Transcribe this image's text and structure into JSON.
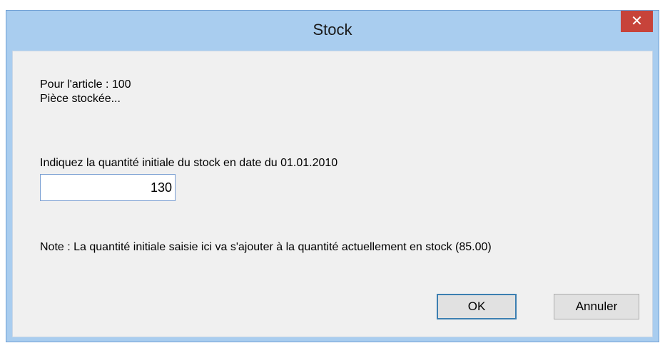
{
  "window": {
    "title": "Stock",
    "close_glyph": "✕"
  },
  "dialog": {
    "article_line": "Pour l'article : 100",
    "description_line": "Pièce stockée...",
    "prompt": "Indiquez la quantité initiale du stock en date du 01.01.2010",
    "quantity_value": "130",
    "note": "Note : La quantité initiale saisie ici va s'ajouter à la quantité actuellement en stock (85.00)"
  },
  "buttons": {
    "ok_label": "OK",
    "cancel_label": "Annuler"
  },
  "colors": {
    "titlebar": "#a9cdef",
    "close_button": "#c7433a",
    "client_background": "#f0f0f0",
    "default_button_border": "#3c7fb1"
  },
  "icons": {
    "close": "close-icon"
  }
}
